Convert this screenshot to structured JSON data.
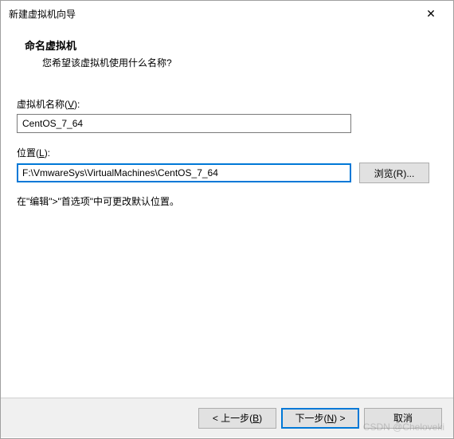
{
  "window": {
    "title": "新建虚拟机向导",
    "close": "✕"
  },
  "header": {
    "title": "命名虚拟机",
    "subtitle": "您希望该虚拟机使用什么名称?"
  },
  "fields": {
    "name_label_pre": "虚拟机名称(",
    "name_label_mn": "V",
    "name_label_post": "):",
    "name_value": "CentOS_7_64",
    "location_label_pre": "位置(",
    "location_label_mn": "L",
    "location_label_post": "):",
    "location_value": "F:\\VmwareSys\\VirtualMachines\\CentOS_7_64",
    "browse_pre": "浏览(",
    "browse_mn": "R",
    "browse_post": ")...",
    "hint": "在\"编辑\">\"首选项\"中可更改默认位置。"
  },
  "footer": {
    "back_pre": "< 上一步(",
    "back_mn": "B",
    "back_post": ")",
    "next_pre": "下一步(",
    "next_mn": "N",
    "next_post": ") >",
    "cancel": "取消"
  },
  "watermark": "CSDN @Cheloveki"
}
